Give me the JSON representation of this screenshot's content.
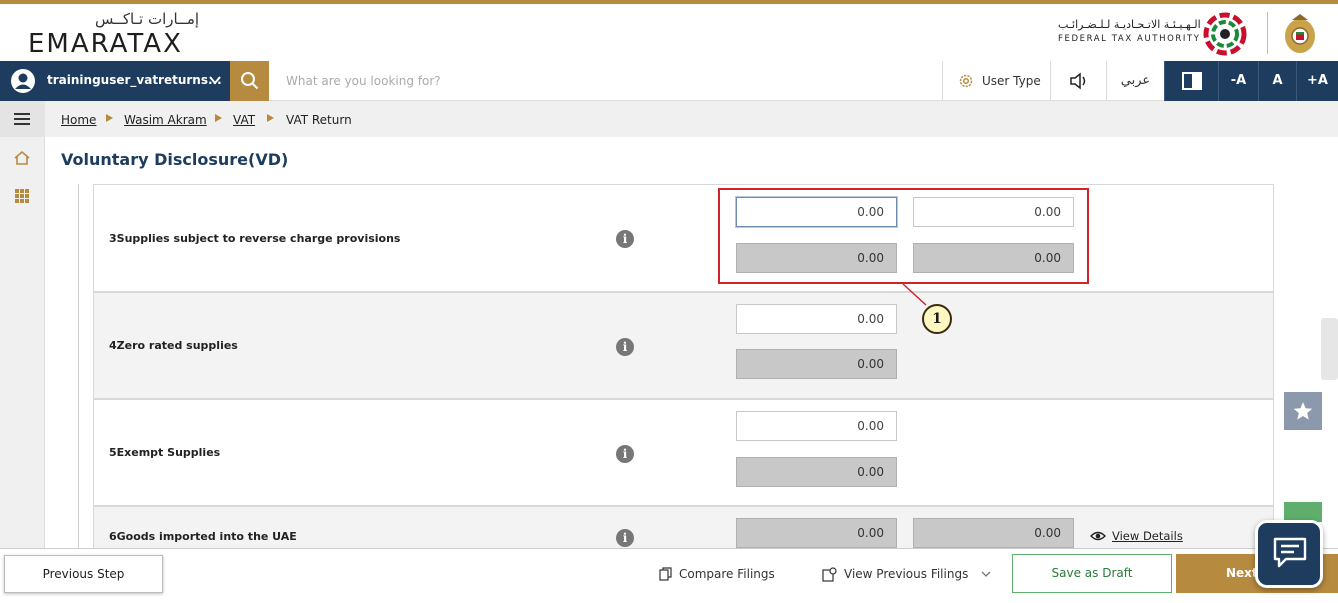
{
  "header": {
    "logo_arabic": "إمــارات تـاكــس",
    "logo_english": "EMARATAX",
    "authority_arabic": "الـهـيـئـة الاتـحـاديـة لـلـضـرائـب",
    "authority_english": "FEDERAL TAX AUTHORITY"
  },
  "nav": {
    "username": "traininguser_vatreturns...",
    "search_placeholder": "What are you looking for?",
    "user_type_label": "User Type",
    "language_label": "عربي",
    "font_decrease": "-A",
    "font_normal": "A",
    "font_increase": "+A"
  },
  "breadcrumb": {
    "items": [
      {
        "label": "Home"
      },
      {
        "label": "Wasim Akram"
      },
      {
        "label": "VAT"
      },
      {
        "label": "VAT Return"
      }
    ]
  },
  "page": {
    "title": "Voluntary Disclosure(VD)"
  },
  "rows": [
    {
      "label": "3Supplies subject to reverse charge provisions",
      "amount": "0.00",
      "vat": "0.00",
      "amount_ro": "0.00",
      "vat_ro": "0.00"
    },
    {
      "label": "4Zero rated supplies",
      "amount": "0.00",
      "amount_ro": "0.00"
    },
    {
      "label": "5Exempt Supplies",
      "amount": "0.00",
      "amount_ro": "0.00"
    },
    {
      "label": "6Goods imported into the UAE",
      "amount_ro": "0.00",
      "vat_ro": "0.00",
      "view_details": "View Details"
    }
  ],
  "annotation": {
    "callout_number": "1",
    "highlight_color": "#d2232a"
  },
  "footer": {
    "previous_step": "Previous Step",
    "compare_filings": "Compare Filings",
    "view_previous_filings": "View Previous Filings",
    "save_as_draft": "Save as Draft",
    "next": "Next"
  },
  "colors": {
    "brand_navy": "#1d3c5e",
    "brand_gold": "#b68a3f",
    "save_green": "#5fae6c"
  }
}
